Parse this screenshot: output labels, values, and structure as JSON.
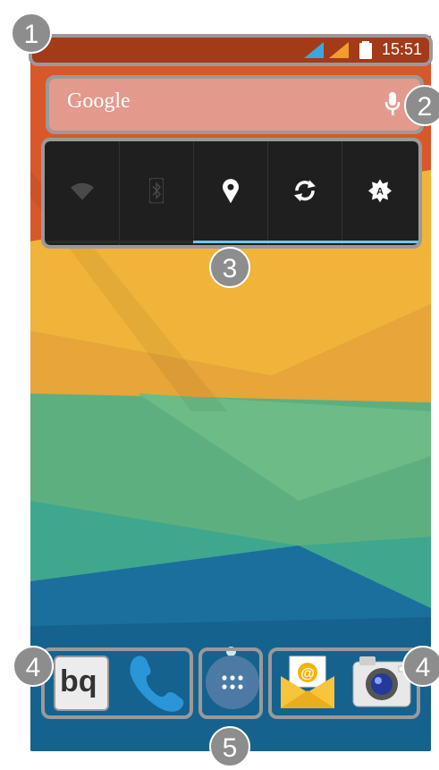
{
  "status_bar": {
    "time": "15:51"
  },
  "search_bar": {
    "label": "Google"
  },
  "quick_settings": [
    {
      "name": "wifi-icon",
      "active": false
    },
    {
      "name": "bluetooth-icon",
      "active": false
    },
    {
      "name": "location-icon",
      "active": true
    },
    {
      "name": "sync-icon",
      "active": true
    },
    {
      "name": "auto-brightness-icon",
      "active": true
    }
  ],
  "callouts": [
    "1",
    "2",
    "3",
    "4",
    "4",
    "5"
  ],
  "colors": {
    "active_indicator": "#6dc9ea",
    "badge": "#8d8d8d",
    "box": "#9a9a9a"
  }
}
